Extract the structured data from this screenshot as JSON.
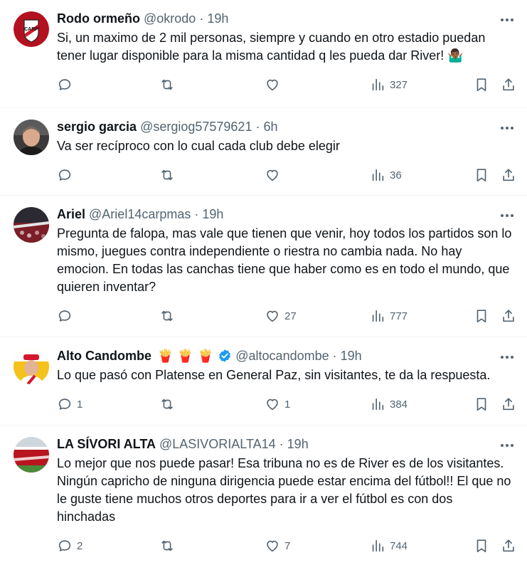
{
  "tweets": [
    {
      "name": "Rodo ormeño",
      "handle": "@okrodo",
      "dot": "·",
      "time": "19h",
      "text": "Si, un maximo de 2 mil personas, siempre y cuando en otro estadio puedan tener lugar disponible para la misma cantidad q les pueda dar River! 🤷🏾‍♂️",
      "replies": "",
      "retweets": "",
      "likes": "",
      "views": "327",
      "avatar": "river-plate-logo"
    },
    {
      "name": "sergio garcia",
      "handle": "@sergiog57579621",
      "dot": "·",
      "time": "6h",
      "text": "Va ser recíproco con lo cual cada club debe elegir",
      "replies": "",
      "retweets": "",
      "likes": "",
      "views": "36",
      "avatar": "man-photo"
    },
    {
      "name": "Ariel",
      "handle": "@Ariel14carpmas",
      "dot": "·",
      "time": "19h",
      "text": "Pregunta de falopa, mas vale que tienen que venir, hoy todos los partidos son lo mismo, juegues contra independiente o riestra no cambia nada. No hay emocion. En todas las canchas tiene que haber como es en todo el mundo, que quieren inventar?",
      "replies": "",
      "retweets": "",
      "likes": "27",
      "views": "777",
      "avatar": "stadium-photo"
    },
    {
      "name": "Alto Candombe",
      "handle": "@altocandombe",
      "dot": "·",
      "time": "19h",
      "text": "Lo que pasó con Platense en General Paz, sin visitantes, te da la respuesta.",
      "replies": "1",
      "retweets": "",
      "likes": "1",
      "views": "384",
      "avatar": "man-cap-photo",
      "name_emojis": [
        "🍟",
        "🍟",
        "🍟"
      ],
      "verified": true
    },
    {
      "name": "LA SÍVORI ALTA",
      "handle": "@LASIVORIALTA14",
      "dot": "·",
      "time": "19h",
      "text": "Lo mejor que nos puede pasar! Esa tribuna no es de River es de los visitantes. Ningún capricho de ninguna dirigencia puede estar encima del fútbol!! El que no le guste tiene muchos otros deportes para ir a ver el fútbol es con dos hinchadas",
      "replies": "2",
      "retweets": "",
      "likes": "7",
      "views": "744",
      "avatar": "crowd-photo"
    }
  ],
  "icons": {
    "more": "more-horizontal-icon",
    "reply": "reply-bubble-icon",
    "retweet": "retweet-arrows-icon",
    "like": "heart-icon",
    "views": "views-bars-icon",
    "bookmark": "bookmark-icon",
    "share": "share-upload-icon",
    "verified": "verified-badge-icon"
  },
  "colors": {
    "text": "#0f1419",
    "secondary": "#536471",
    "border": "#eff3f4",
    "verified": "#1d9bf0",
    "river_red": "#d5172b"
  }
}
